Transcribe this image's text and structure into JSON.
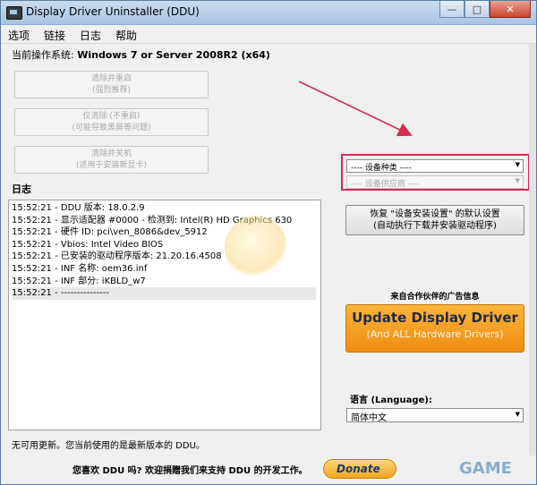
{
  "window": {
    "title": "Display Driver Uninstaller (DDU)",
    "controls": {
      "minimize": "—",
      "maximize": "□",
      "close": "✕"
    }
  },
  "menu": [
    "选项",
    "链接",
    "日志",
    "帮助"
  ],
  "os": {
    "label": "当前操作系统: ",
    "value": "Windows 7 or Server 2008R2 (x64)"
  },
  "disabled_buttons": [
    {
      "line1": "清除并重启",
      "line2": "(强烈推荐)"
    },
    {
      "line1": "仅清除 (不重启)",
      "line2": "(可能导致黑屏等问题)"
    },
    {
      "line1": "清除并关机",
      "line2": "(适用于安装新显卡)"
    }
  ],
  "log": {
    "label": "日志",
    "lines": [
      "15:52:21 - DDU 版本: 18.0.2.9",
      "15:52:21 - 显示适配器 #0000 - 检测到: Intel(R) HD Graphics 630",
      "15:52:21 - 硬件 ID: pci\\ven_8086&dev_5912",
      "15:52:21 - Vbios: Intel Video BIOS",
      "15:52:21 - 已安装的驱动程序版本: 21.20.16.4508",
      "15:52:21 - INF 名称: oem36.inf",
      "15:52:21 - INF 部分: iKBLD_w7",
      "15:52:21 - ---------------"
    ]
  },
  "device_type_select": {
    "value": "---- 设备种类 ----"
  },
  "vendor_select": {
    "value": "---- 设备供应商 ----"
  },
  "restore_button": {
    "line1": "恢复 \"设备安装设置\" 的默认设置",
    "line2": "(自动执行下载并安装驱动程序)"
  },
  "ad": {
    "label": "来自合作伙伴的广告信息",
    "title": "Update Display Driver",
    "subtitle": "(And ALL Hardware Drivers)"
  },
  "language": {
    "label": "语言 (Language):",
    "value": "简体中文"
  },
  "status": "无可用更新。您当前使用的是最新版本的 DDU。",
  "footer": {
    "text": "您喜欢 DDU 吗? 欢迎捐赠我们来支持 DDU 的开发工作。",
    "donate_label": "Donate"
  },
  "watermark": "GAME",
  "colors": {
    "annotation": "#d42b50",
    "ad_orange": "#f59a1c"
  }
}
